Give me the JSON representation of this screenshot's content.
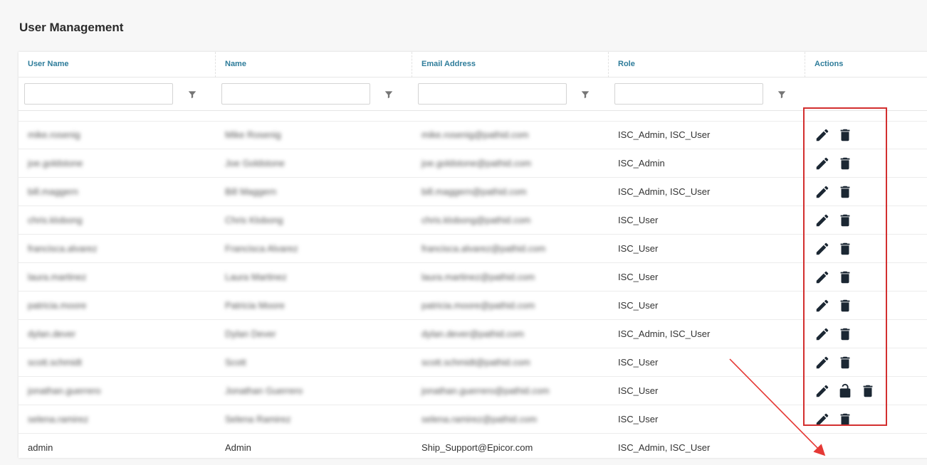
{
  "page": {
    "title": "User Management"
  },
  "grid": {
    "columns": [
      {
        "key": "username",
        "label": "User Name"
      },
      {
        "key": "name",
        "label": "Name"
      },
      {
        "key": "email",
        "label": "Email Address"
      },
      {
        "key": "role",
        "label": "Role"
      },
      {
        "key": "actions",
        "label": "Actions"
      }
    ],
    "filters": [
      {
        "value": "",
        "placeholder": ""
      },
      {
        "value": "",
        "placeholder": ""
      },
      {
        "value": "",
        "placeholder": ""
      },
      {
        "value": "",
        "placeholder": ""
      }
    ],
    "rows": [
      {
        "username": "mike.rosenig",
        "name": "Mike Rosenig",
        "email": "mike.rosenig@pathid.com",
        "role": "ISC_Admin, ISC_User",
        "blurred": true,
        "actions": [
          "edit",
          "delete"
        ]
      },
      {
        "username": "joe.goldstone",
        "name": "Joe Goldstone",
        "email": "joe.goldstone@pathid.com",
        "role": "ISC_Admin",
        "blurred": true,
        "actions": [
          "edit",
          "delete"
        ]
      },
      {
        "username": "bill.maggern",
        "name": "Bill Maggern",
        "email": "bill.maggern@pathid.com",
        "role": "ISC_Admin, ISC_User",
        "blurred": true,
        "actions": [
          "edit",
          "delete"
        ]
      },
      {
        "username": "chris.klobong",
        "name": "Chris Klobong",
        "email": "chris.klobong@pathid.com",
        "role": "ISC_User",
        "blurred": true,
        "actions": [
          "edit",
          "delete"
        ]
      },
      {
        "username": "francisca.alvarez",
        "name": "Francisca Alvarez",
        "email": "francisca.alvarez@pathid.com",
        "role": "ISC_User",
        "blurred": true,
        "actions": [
          "edit",
          "delete"
        ]
      },
      {
        "username": "laura.martinez",
        "name": "Laura Martinez",
        "email": "laura.martinez@pathid.com",
        "role": "ISC_User",
        "blurred": true,
        "actions": [
          "edit",
          "delete"
        ]
      },
      {
        "username": "patricia.moore",
        "name": "Patricia Moore",
        "email": "patricia.moore@pathid.com",
        "role": "ISC_User",
        "blurred": true,
        "actions": [
          "edit",
          "delete"
        ]
      },
      {
        "username": "dylan.dever",
        "name": "Dylan Dever",
        "email": "dylan.dever@pathid.com",
        "role": "ISC_Admin, ISC_User",
        "blurred": true,
        "actions": [
          "edit",
          "delete"
        ]
      },
      {
        "username": "scott.schmidt",
        "name": "Scott",
        "email": "scott.schmidt@pathid.com",
        "role": "ISC_User",
        "blurred": true,
        "actions": [
          "edit",
          "delete"
        ]
      },
      {
        "username": "jonathan.guerrero",
        "name": "Jonathan Guerrero",
        "email": "jonathan.guerrero@pathid.com",
        "role": "ISC_User",
        "blurred": true,
        "actions": [
          "edit",
          "unlock",
          "delete"
        ]
      },
      {
        "username": "selena.ramirez",
        "name": "Selena Ramirez",
        "email": "selena.ramirez@pathid.com",
        "role": "ISC_User",
        "blurred": true,
        "actions": [
          "edit",
          "delete"
        ]
      },
      {
        "username": "admin",
        "name": "Admin",
        "email": "Ship_Support@Epicor.com",
        "role": "ISC_Admin, ISC_User",
        "blurred": false,
        "actions": []
      }
    ]
  },
  "colors": {
    "header_text": "#2e7c9a",
    "icon": "#1b2733",
    "highlight": "#d32f2f",
    "arrow": "#e53935"
  }
}
